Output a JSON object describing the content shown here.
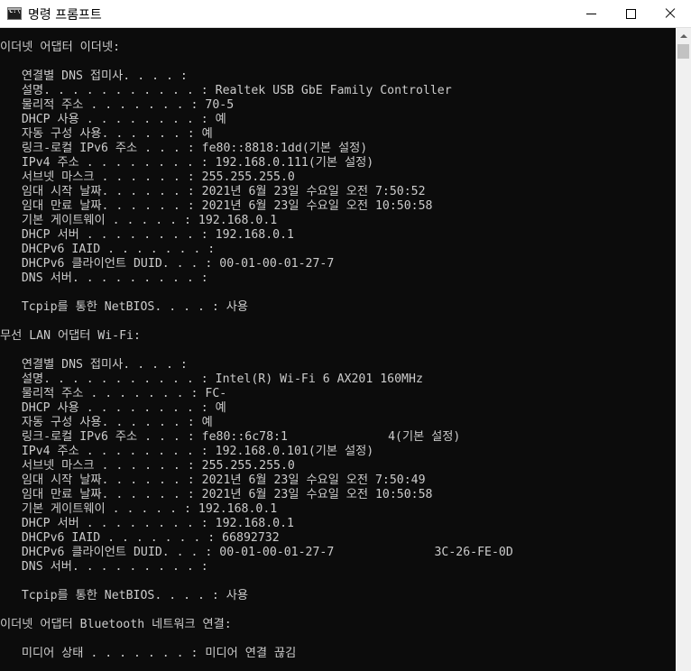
{
  "window": {
    "title": "명령 프롬프트"
  },
  "console": {
    "lines": [
      "이더넷 어댑터 이더넷:",
      "",
      "   연결별 DNS 접미사. . . . :",
      "   설명. . . . . . . . . . . : Realtek USB GbE Family Controller",
      "   물리적 주소 . . . . . . . : 70-5",
      "   DHCP 사용 . . . . . . . . : 예",
      "   자동 구성 사용. . . . . . : 예",
      "   링크-로컬 IPv6 주소 . . . : fe80::8818:1dd(기본 설정)",
      "   IPv4 주소 . . . . . . . . : 192.168.0.111(기본 설정)",
      "   서브넷 마스크 . . . . . . : 255.255.255.0",
      "   임대 시작 날짜. . . . . . : 2021년 6월 23일 수요일 오전 7:50:52",
      "   임대 만료 날짜. . . . . . : 2021년 6월 23일 수요일 오전 10:50:58",
      "   기본 게이트웨이 . . . . . : 192.168.0.1",
      "   DHCP 서버 . . . . . . . . : 192.168.0.1",
      "   DHCPv6 IAID . . . . . . . :",
      "   DHCPv6 클라이언트 DUID. . . : 00-01-00-01-27-7",
      "   DNS 서버. . . . . . . . . :",
      "",
      "   Tcpip를 통한 NetBIOS. . . . : 사용",
      "",
      "무선 LAN 어댑터 Wi-Fi:",
      "",
      "   연결별 DNS 접미사. . . . :",
      "   설명. . . . . . . . . . . : Intel(R) Wi-Fi 6 AX201 160MHz",
      "   물리적 주소 . . . . . . . : FC-",
      "   DHCP 사용 . . . . . . . . : 예",
      "   자동 구성 사용. . . . . . : 예",
      "   링크-로컬 IPv6 주소 . . . : fe80::6c78:1              4(기본 설정)",
      "   IPv4 주소 . . . . . . . . : 192.168.0.101(기본 설정)",
      "   서브넷 마스크 . . . . . . : 255.255.255.0",
      "   임대 시작 날짜. . . . . . : 2021년 6월 23일 수요일 오전 7:50:49",
      "   임대 만료 날짜. . . . . . : 2021년 6월 23일 수요일 오전 10:50:58",
      "   기본 게이트웨이 . . . . . : 192.168.0.1",
      "   DHCP 서버 . . . . . . . . : 192.168.0.1",
      "   DHCPv6 IAID . . . . . . . : 66892732",
      "   DHCPv6 클라이언트 DUID. . . : 00-01-00-01-27-7              3C-26-FE-0D",
      "   DNS 서버. . . . . . . . . :",
      "",
      "   Tcpip를 통한 NetBIOS. . . . : 사용",
      "",
      "이더넷 어댑터 Bluetooth 네트워크 연결:",
      "",
      "   미디어 상태 . . . . . . . : 미디어 연결 끊김"
    ]
  }
}
